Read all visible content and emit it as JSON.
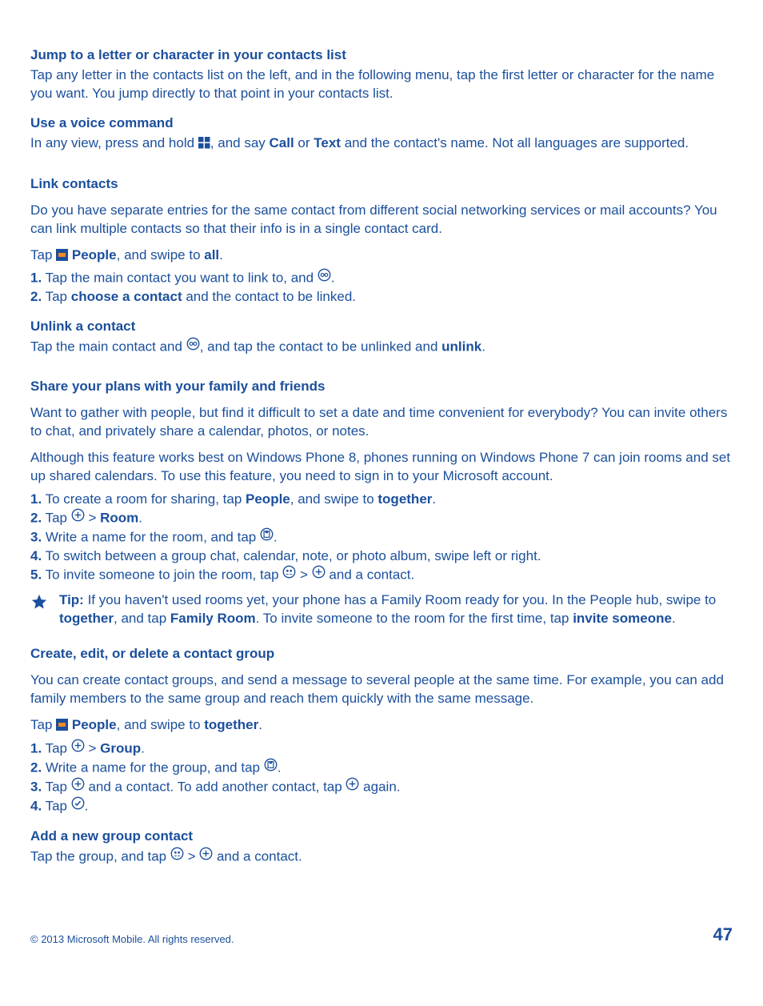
{
  "s1": {
    "h": "Jump to a letter or character in your contacts list",
    "p": "Tap any letter in the contacts list on the left, and in the following menu, tap the first letter or character for the name you want. You jump directly to that point in your contacts list."
  },
  "s2": {
    "h": "Use a voice command",
    "pre": "In any view, press and hold ",
    "mid1": ", and say ",
    "call": "Call",
    "or": " or ",
    "text": "Text",
    "post": " and the contact's name. Not all languages are supported."
  },
  "s3": {
    "h": "Link contacts",
    "p1": "Do you have separate entries for the same contact from different social networking services or mail accounts? You can link multiple contacts so that their info is in a single contact card.",
    "tap": "Tap ",
    "people": "People",
    "swipe": ", and swipe to ",
    "all": "all",
    "dot": ".",
    "l1a": "1.",
    "l1b": " Tap the main contact you want to link to, and ",
    "l2a": "2.",
    "l2b": " Tap ",
    "l2c": "choose a contact",
    "l2d": " and the contact to be linked."
  },
  "s4": {
    "h": "Unlink a contact",
    "pre": "Tap the main contact and ",
    "mid": ", and tap the contact to be unlinked and ",
    "unlink": "unlink",
    "dot": "."
  },
  "s5": {
    "h": "Share your plans with your family and friends",
    "p1": "Want to gather with people, but find it difficult to set a date and time convenient for everybody? You can invite others to chat, and privately share a calendar, photos, or notes.",
    "p2": "Although this feature works best on Windows Phone 8, phones running on Windows Phone 7 can join rooms and set up shared calendars. To use this feature, you need to sign in to your Microsoft account.",
    "l1a": "1.",
    "l1b": " To create a room for sharing, tap ",
    "l1c": "People",
    "l1d": ", and swipe to ",
    "l1e": "together",
    "l1f": ".",
    "l2a": "2.",
    "l2b": " Tap ",
    "l2c": " > ",
    "l2d": "Room",
    "l2e": ".",
    "l3a": "3.",
    "l3b": " Write a name for the room, and tap ",
    "l3c": ".",
    "l4a": "4.",
    "l4b": " To switch between a group chat, calendar, note, or photo album, swipe left or right.",
    "l5a": "5.",
    "l5b": " To invite someone to join the room, tap ",
    "l5c": " > ",
    "l5d": " and a contact.",
    "tip_label": "Tip:",
    "tip_a": " If you haven't used rooms yet, your phone has a Family Room ready for you. In the People hub, swipe to ",
    "tip_b": "together",
    "tip_c": ", and tap ",
    "tip_d": "Family Room",
    "tip_e": ". To invite someone to the room for the first time, tap ",
    "tip_f": "invite someone",
    "tip_g": "."
  },
  "s6": {
    "h": "Create, edit, or delete a contact group",
    "p1": "You can create contact groups, and send a message to several people at the same time. For example, you can add family members to the same group and reach them quickly with the same message.",
    "tap": "Tap ",
    "people": "People",
    "swipe": ", and swipe to ",
    "together": "together",
    "dot": ".",
    "l1a": "1.",
    "l1b": " Tap ",
    "l1c": " > ",
    "l1d": "Group",
    "l1e": ".",
    "l2a": "2.",
    "l2b": " Write a name for the group, and tap ",
    "l2c": ".",
    "l3a": "3.",
    "l3b": " Tap ",
    "l3c": " and a contact. To add another contact, tap ",
    "l3d": " again.",
    "l4a": "4.",
    "l4b": " Tap ",
    "l4c": "."
  },
  "s7": {
    "h": "Add a new group contact",
    "pre": "Tap the group, and tap ",
    "mid": " > ",
    "post": " and a contact."
  },
  "footer": {
    "copyright": "© 2013 Microsoft Mobile. All rights reserved.",
    "page": "47"
  }
}
